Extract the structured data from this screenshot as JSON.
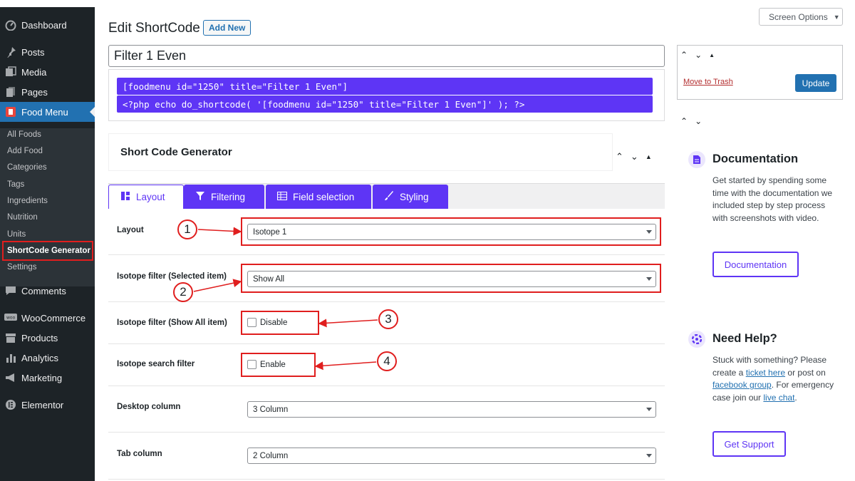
{
  "sidebar": {
    "items": [
      {
        "label": "Dashboard",
        "icon": "dashboard-icon"
      },
      {
        "label": "Posts",
        "icon": "pin-icon"
      },
      {
        "label": "Media",
        "icon": "media-icon"
      },
      {
        "label": "Pages",
        "icon": "pages-icon"
      },
      {
        "label": "Food Menu",
        "icon": "food-menu-icon"
      },
      {
        "label": "Comments",
        "icon": "comment-icon"
      },
      {
        "label": "WooCommerce",
        "icon": "woocommerce-icon"
      },
      {
        "label": "Products",
        "icon": "archive-icon"
      },
      {
        "label": "Analytics",
        "icon": "chart-bar-icon"
      },
      {
        "label": "Marketing",
        "icon": "megaphone-icon"
      },
      {
        "label": "Elementor",
        "icon": "elementor-icon"
      }
    ],
    "submenu": [
      "All Foods",
      "Add Food",
      "Categories",
      "Tags",
      "Ingredients",
      "Nutrition",
      "Units",
      "ShortCode Generator",
      "Settings"
    ]
  },
  "header": {
    "title": "Edit ShortCode",
    "add_new": "Add New",
    "screen_options": "Screen Options"
  },
  "post": {
    "title_value": "Filter 1 Even",
    "shortcode": "[foodmenu id=\"1250\" title=\"Filter 1 Even\"]",
    "php_code": "<?php echo do_shortcode( '[foodmenu id=\"1250\" title=\"Filter 1 Even\"]' ); ?>"
  },
  "generator": {
    "title": "Short Code Generator",
    "tabs": [
      {
        "label": "Layout",
        "icon": "layout-icon"
      },
      {
        "label": "Filtering",
        "icon": "filter-icon"
      },
      {
        "label": "Field selection",
        "icon": "table-icon"
      },
      {
        "label": "Styling",
        "icon": "brush-icon"
      }
    ],
    "rows": [
      {
        "label": "Layout",
        "value": "Isotope 1"
      },
      {
        "label": "Isotope filter (Selected item)",
        "value": "Show All"
      },
      {
        "label": "Isotope filter (Show All item)",
        "checkbox_label": "Disable"
      },
      {
        "label": "Isotope search filter",
        "checkbox_label": "Enable"
      },
      {
        "label": "Desktop column",
        "value": "3 Column"
      },
      {
        "label": "Tab column",
        "value": "2 Column"
      }
    ]
  },
  "annotations": [
    "1",
    "2",
    "3",
    "4"
  ],
  "publish": {
    "trash": "Move to Trash",
    "update": "Update"
  },
  "documentation": {
    "title": "Documentation",
    "text": "Get started by spending some time with the documentation we included step by step process with screenshots with video.",
    "button": "Documentation"
  },
  "help": {
    "title": "Need Help?",
    "text_1": "Stuck with something? Please create a ",
    "link_1": "ticket here",
    "text_2": " or post on ",
    "link_2": "facebook group",
    "text_3": ". For emergency case join our ",
    "link_3": "live chat",
    "text_4": ".",
    "button": "Get Support"
  },
  "colors": {
    "accent": "#5e35f5",
    "wp_blue": "#2271b1",
    "annotation_red": "#e01e1e",
    "sidebar_bg": "#1d2327"
  }
}
